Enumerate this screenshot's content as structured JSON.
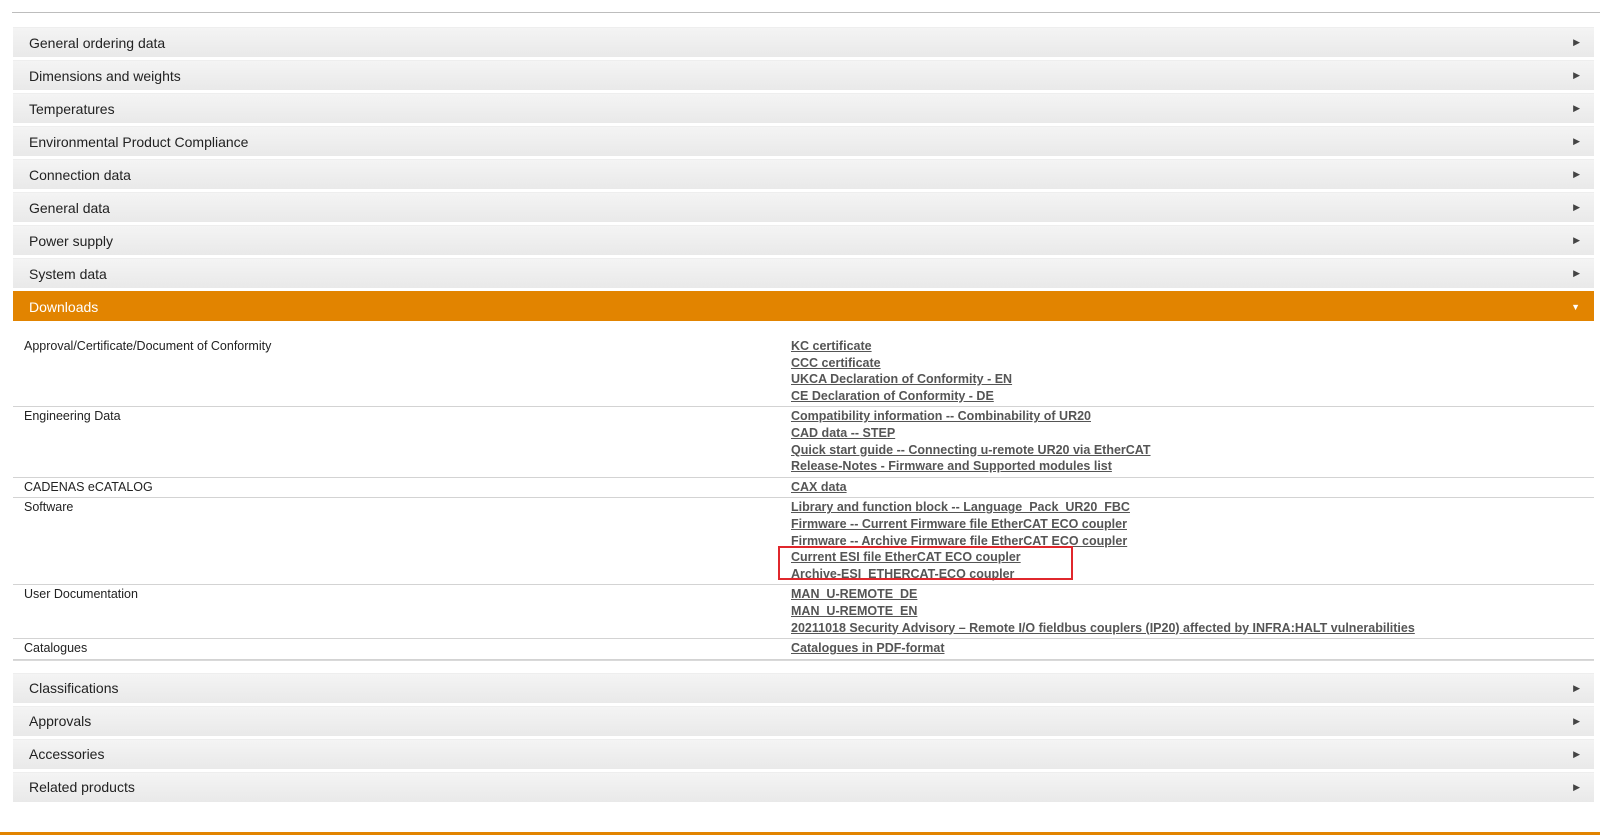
{
  "accordion_top": [
    {
      "label": "General ordering data"
    },
    {
      "label": "Dimensions and weights"
    },
    {
      "label": "Temperatures"
    },
    {
      "label": "Environmental Product Compliance"
    },
    {
      "label": "Connection data"
    },
    {
      "label": "General data"
    },
    {
      "label": "Power supply"
    },
    {
      "label": "System data"
    }
  ],
  "downloads": {
    "label": "Downloads",
    "rows": [
      {
        "category": "Approval/Certificate/Document of Conformity",
        "links": [
          "KC certificate",
          "CCC certificate",
          "UKCA Declaration of Conformity - EN",
          "CE Declaration of Conformity - DE"
        ]
      },
      {
        "category": "Engineering Data",
        "links": [
          "Compatibility information -- Combinability of UR20",
          "CAD data -- STEP",
          "Quick start guide -- Connecting u-remote UR20 via EtherCAT",
          "Release-Notes - Firmware and Supported modules list"
        ]
      },
      {
        "category": "CADENAS eCATALOG",
        "links": [
          "CAX data"
        ]
      },
      {
        "category": "Software",
        "links": [
          "Library and function block -- Language_Pack_UR20_FBC",
          "Firmware -- Current Firmware file EtherCAT ECO coupler",
          "Firmware -- Archive Firmware file EtherCAT ECO coupler",
          "Current ESI file EtherCAT ECO coupler",
          "Archive-ESI_ETHERCAT-ECO coupler"
        ]
      },
      {
        "category": "User Documentation",
        "links": [
          "MAN_U-REMOTE_DE",
          "MAN_U-REMOTE_EN",
          "20211018 Security Advisory – Remote I/O fieldbus couplers (IP20) affected by INFRA:HALT vulnerabilities"
        ]
      },
      {
        "category": "Catalogues",
        "links": [
          "Catalogues in PDF-format"
        ]
      }
    ]
  },
  "accordion_bottom": [
    {
      "label": "Classifications"
    },
    {
      "label": "Approvals"
    },
    {
      "label": "Accessories"
    },
    {
      "label": "Related products"
    }
  ],
  "colors": {
    "accent": "#e28400",
    "highlight_box": "#e0272c",
    "link": "#555555"
  },
  "icons": {
    "collapsed": "triangle-right-icon",
    "expanded": "triangle-down-icon"
  }
}
